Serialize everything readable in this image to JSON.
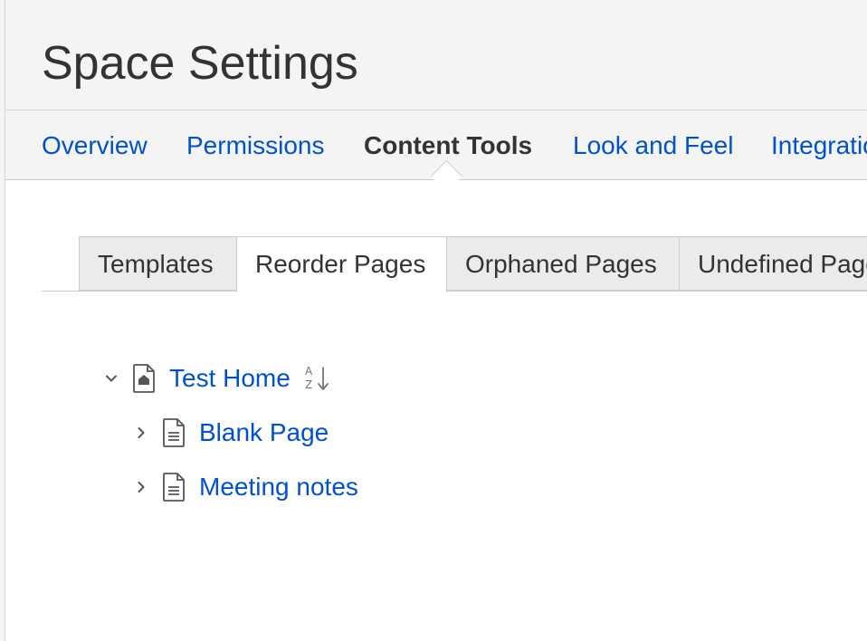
{
  "header": {
    "title": "Space Settings"
  },
  "nav": {
    "tabs": [
      {
        "label": "Overview",
        "active": false
      },
      {
        "label": "Permissions",
        "active": false
      },
      {
        "label": "Content Tools",
        "active": true
      },
      {
        "label": "Look and Feel",
        "active": false
      },
      {
        "label": "Integrations",
        "active": false
      }
    ]
  },
  "subtabs": [
    {
      "label": "Templates",
      "active": false
    },
    {
      "label": "Reorder Pages",
      "active": true
    },
    {
      "label": "Orphaned Pages",
      "active": false
    },
    {
      "label": "Undefined Pages",
      "active": false
    }
  ],
  "tree": {
    "root": {
      "label": "Test Home",
      "expanded": true,
      "icon": "home-page-icon"
    },
    "children": [
      {
        "label": "Blank Page",
        "expanded": false,
        "icon": "page-icon"
      },
      {
        "label": "Meeting notes",
        "expanded": false,
        "icon": "page-icon"
      }
    ],
    "sort_icon": "sort-alphabetical-icon"
  },
  "colors": {
    "link": "#0052cc",
    "text": "#333333",
    "header_bg": "#f4f4f4",
    "tab_bg": "#ebebeb",
    "border": "#cccccc"
  }
}
